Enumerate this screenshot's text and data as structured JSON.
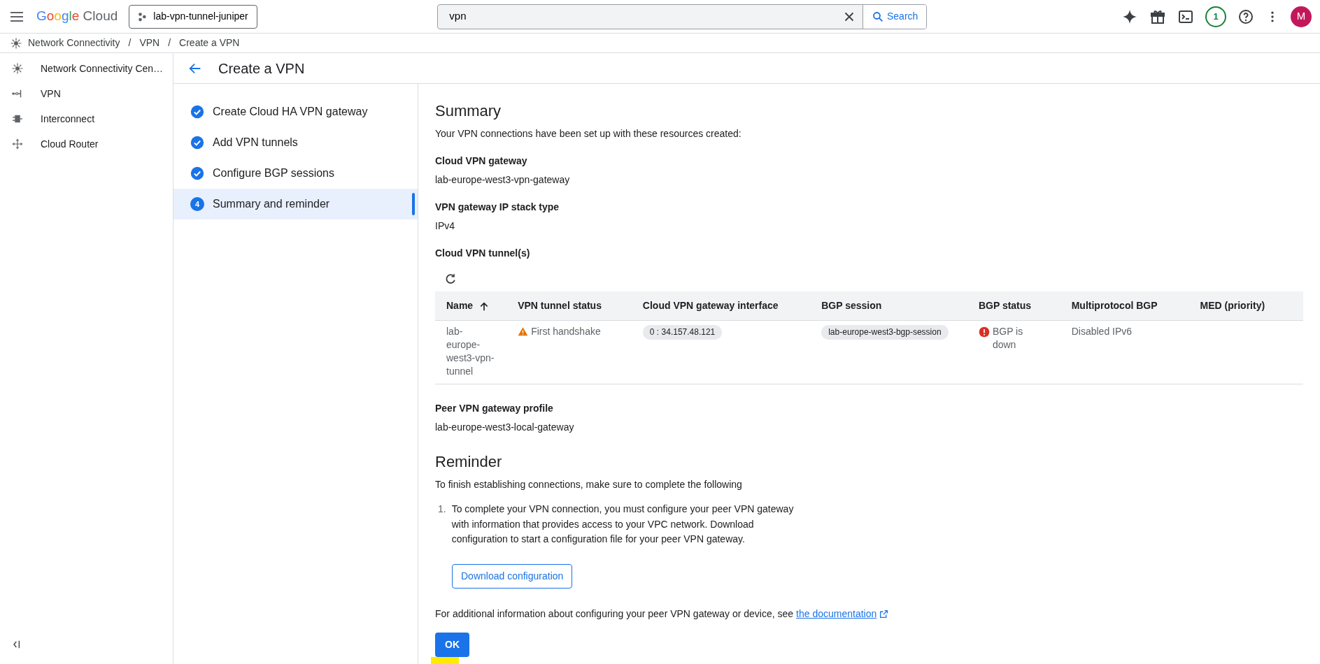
{
  "top_bar": {
    "logo": "Google Cloud",
    "project": "lab-vpn-tunnel-juniper",
    "search": {
      "value": "vpn",
      "button": "Search"
    },
    "notification_count": "1",
    "avatar_initial": "M"
  },
  "breadcrumb": {
    "items": [
      "Network Connectivity",
      "VPN",
      "Create a VPN"
    ],
    "separators": [
      "/",
      "/"
    ]
  },
  "sidebar": {
    "items": [
      {
        "label": "Network Connectivity Cen…",
        "kind": "hub"
      },
      {
        "label": "VPN",
        "kind": "vpn"
      },
      {
        "label": "Interconnect",
        "kind": "interconnect"
      },
      {
        "label": "Cloud Router",
        "kind": "router"
      }
    ]
  },
  "page_title": "Create a VPN",
  "steps": [
    {
      "label": "Create Cloud HA VPN gateway",
      "done": true,
      "selected": false
    },
    {
      "label": "Add VPN tunnels",
      "done": true,
      "selected": false
    },
    {
      "label": "Configure BGP sessions",
      "done": true,
      "selected": false
    },
    {
      "label": "Summary and reminder",
      "done": false,
      "selected": true,
      "number": "4"
    }
  ],
  "summary": {
    "title": "Summary",
    "intro": "Your VPN connections have been set up with these resources created:",
    "fields": [
      {
        "label": "Cloud VPN gateway",
        "value": "lab-europe-west3-vpn-gateway"
      },
      {
        "label": "VPN gateway IP stack type",
        "value": "IPv4"
      }
    ],
    "tunnels_label": "Cloud VPN tunnel(s)",
    "table": {
      "columns": [
        {
          "label": "Name",
          "sorted": true
        },
        {
          "label": "VPN tunnel status",
          "sorted": false
        },
        {
          "label": "Cloud VPN gateway interface",
          "sorted": false
        },
        {
          "label": "BGP session",
          "sorted": false
        },
        {
          "label": "BGP status",
          "sorted": false
        },
        {
          "label": "Multiprotocol BGP",
          "sorted": false
        },
        {
          "label": "MED (priority)",
          "sorted": false
        }
      ],
      "rows": [
        {
          "name": "lab-europe-west3-vpn-tunnel",
          "tunnel_status": {
            "kind": "warning",
            "text": "First handshake"
          },
          "interface": "0 : 34.157.48.121",
          "bgp_session": "lab-europe-west3-bgp-session",
          "bgp_status": {
            "kind": "error",
            "text": "BGP is down"
          },
          "multiprotocol_bgp": "Disabled IPv6"
        }
      ]
    },
    "peer": {
      "label": "Peer VPN gateway profile",
      "value": "lab-europe-west3-local-gateway"
    }
  },
  "reminder": {
    "title": "Reminder",
    "intro": "To finish establishing connections, make sure to complete the following",
    "steps": [
      {
        "number": "1.",
        "text": "To complete your VPN connection, you must configure your peer VPN gateway with information that provides access to your VPC network. Download configuration to start a configuration file for your peer VPN gateway."
      }
    ],
    "download_button": "Download configuration",
    "footer_text": "For additional information about configuring your peer VPN gateway or device, see",
    "footer_link": "the documentation"
  },
  "ok_button": "OK"
}
